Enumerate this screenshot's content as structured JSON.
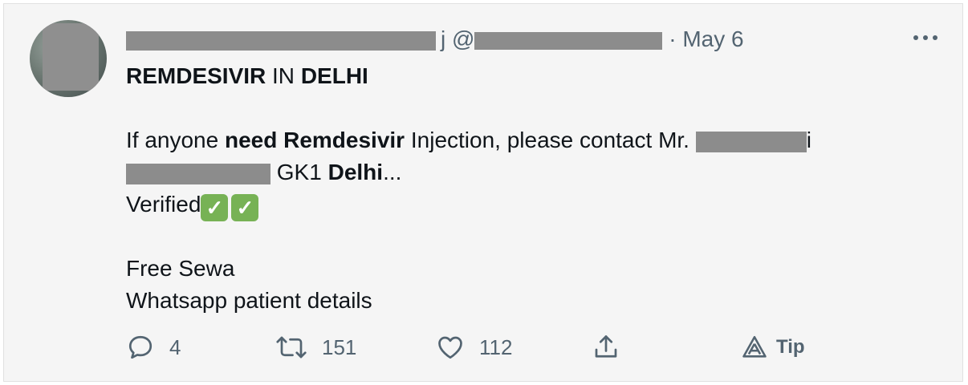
{
  "tweet": {
    "date": "May 6",
    "handle_prefix": "@",
    "handle_suffix": "·",
    "name_tail": "j",
    "title": {
      "part1": "REMDESIVIR",
      "part2": " IN ",
      "part3": "DELHI"
    },
    "line1": {
      "a": "If anyone ",
      "b": "need Remdesivir",
      "c": " Injection, please contact Mr. ",
      "d": "i"
    },
    "line2": {
      "a": " GK1 ",
      "b": "Delhi",
      "c": "..."
    },
    "line3": {
      "a": "Verified",
      "checks": [
        "✓",
        "✓"
      ]
    },
    "line4": "Free Sewa",
    "line5": "Whatsapp patient details"
  },
  "actions": {
    "reply_count": "4",
    "retweet_count": "151",
    "like_count": "112",
    "tip_label": "Tip"
  },
  "colors": {
    "check_green": "#77b255",
    "muted": "#536471",
    "text": "#0f1419",
    "background": "#f5f5f5"
  },
  "icons": [
    "reply-icon",
    "retweet-icon",
    "like-icon",
    "share-icon",
    "tip-icon",
    "more-icon"
  ]
}
